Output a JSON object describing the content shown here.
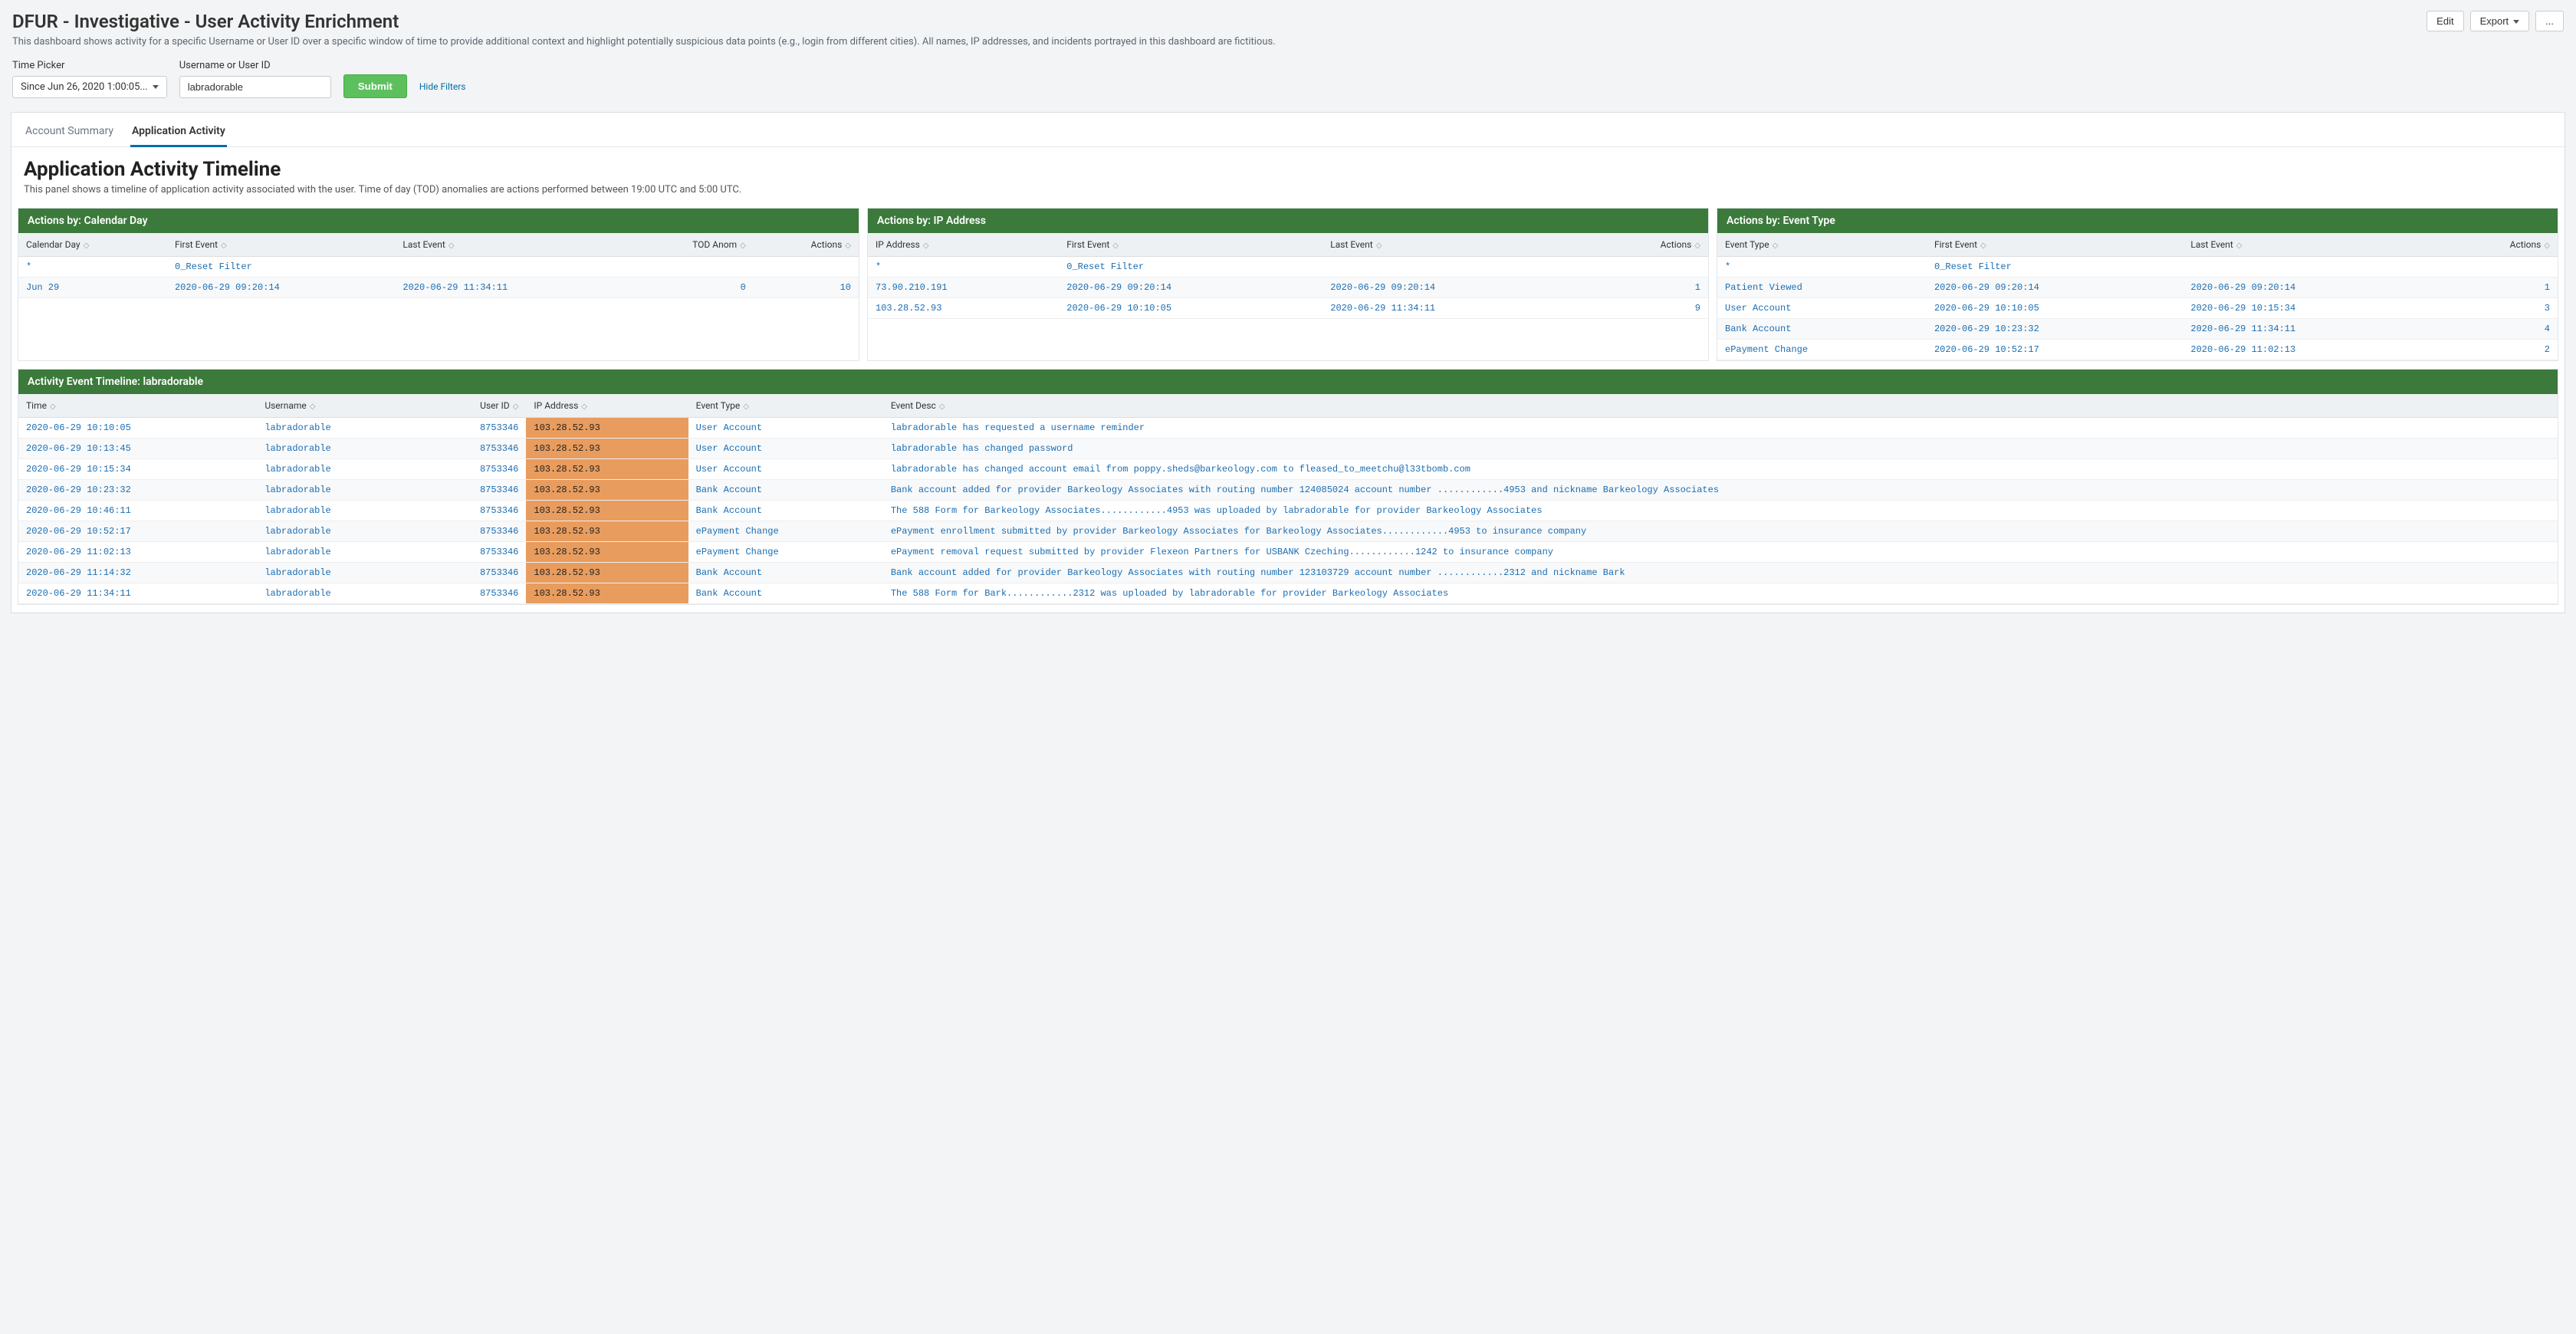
{
  "header": {
    "title": "DFUR - Investigative - User Activity Enrichment",
    "subtitle": "This dashboard shows activity for a specific Username or User ID over a specific window of time to provide additional context and highlight potentially suspicious data points (e.g., login from different cities). All names, IP addresses, and incidents portrayed in this dashboard are fictitious.",
    "edit": "Edit",
    "export": "Export",
    "more": "..."
  },
  "filters": {
    "timepicker_label": "Time Picker",
    "timepicker_value": "Since Jun 26, 2020 1:00:05...",
    "username_label": "Username or User ID",
    "username_value": "labradorable",
    "submit": "Submit",
    "hide_filters": "Hide Filters"
  },
  "tabs": {
    "summary": "Account Summary",
    "activity": "Application Activity"
  },
  "section": {
    "title": "Application Activity Timeline",
    "desc": "This panel shows a timeline of application activity associated with the user. Time of day (TOD) anomalies are actions performed between 19:00 UTC and 5:00 UTC."
  },
  "panel1": {
    "title": "Actions by: Calendar Day",
    "cols": {
      "c1": "Calendar Day",
      "c2": "First Event",
      "c3": "Last Event",
      "c4": "TOD Anom",
      "c5": "Actions"
    },
    "rows": [
      {
        "c1": "*",
        "c2": "0_Reset Filter",
        "c3": "",
        "c4": "",
        "c5": ""
      },
      {
        "c1": "Jun 29",
        "c2": "2020-06-29 09:20:14",
        "c3": "2020-06-29 11:34:11",
        "c4": "0",
        "c5": "10"
      }
    ]
  },
  "panel2": {
    "title": "Actions by: IP Address",
    "cols": {
      "c1": "IP Address",
      "c2": "First Event",
      "c3": "Last Event",
      "c4": "Actions"
    },
    "rows": [
      {
        "c1": "*",
        "c2": "0_Reset Filter",
        "c3": "",
        "c4": ""
      },
      {
        "c1": "73.90.210.191",
        "c2": "2020-06-29 09:20:14",
        "c3": "2020-06-29 09:20:14",
        "c4": "1"
      },
      {
        "c1": "103.28.52.93",
        "c2": "2020-06-29 10:10:05",
        "c3": "2020-06-29 11:34:11",
        "c4": "9"
      }
    ]
  },
  "panel3": {
    "title": "Actions by: Event Type",
    "cols": {
      "c1": "Event Type",
      "c2": "First Event",
      "c3": "Last Event",
      "c4": "Actions"
    },
    "rows": [
      {
        "c1": "*",
        "c2": "0_Reset Filter",
        "c3": "",
        "c4": ""
      },
      {
        "c1": "Patient Viewed",
        "c2": "2020-06-29 09:20:14",
        "c3": "2020-06-29 09:20:14",
        "c4": "1"
      },
      {
        "c1": "User Account",
        "c2": "2020-06-29 10:10:05",
        "c3": "2020-06-29 10:15:34",
        "c4": "3"
      },
      {
        "c1": "Bank Account",
        "c2": "2020-06-29 10:23:32",
        "c3": "2020-06-29 11:34:11",
        "c4": "4"
      },
      {
        "c1": "ePayment Change",
        "c2": "2020-06-29 10:52:17",
        "c3": "2020-06-29 11:02:13",
        "c4": "2"
      }
    ]
  },
  "timeline": {
    "title": "Activity Event Timeline: labradorable",
    "cols": {
      "c1": "Time",
      "c2": "Username",
      "c3": "User ID",
      "c4": "IP Address",
      "c5": "Event Type",
      "c6": "Event Desc"
    },
    "rows": [
      {
        "time": "2020-06-29 10:10:05",
        "user": "labradorable",
        "uid": "8753346",
        "ip": "103.28.52.93",
        "et": "User Account",
        "desc": "labradorable has requested a username reminder"
      },
      {
        "time": "2020-06-29 10:13:45",
        "user": "labradorable",
        "uid": "8753346",
        "ip": "103.28.52.93",
        "et": "User Account",
        "desc": "labradorable has changed password"
      },
      {
        "time": "2020-06-29 10:15:34",
        "user": "labradorable",
        "uid": "8753346",
        "ip": "103.28.52.93",
        "et": "User Account",
        "desc": "labradorable has changed account email from poppy.sheds@barkeology.com to fleased_to_meetchu@l33tbomb.com"
      },
      {
        "time": "2020-06-29 10:23:32",
        "user": "labradorable",
        "uid": "8753346",
        "ip": "103.28.52.93",
        "et": "Bank Account",
        "desc": "Bank account added for provider Barkeology Associates with routing number 124085024 account number ............4953 and nickname Barkeology Associates"
      },
      {
        "time": "2020-06-29 10:46:11",
        "user": "labradorable",
        "uid": "8753346",
        "ip": "103.28.52.93",
        "et": "Bank Account",
        "desc": "The 588 Form for Barkeology Associates............4953 was uploaded by labradorable for provider Barkeology Associates"
      },
      {
        "time": "2020-06-29 10:52:17",
        "user": "labradorable",
        "uid": "8753346",
        "ip": "103.28.52.93",
        "et": "ePayment Change",
        "desc": "ePayment enrollment submitted by provider Barkeology Associates for Barkeology Associates............4953 to insurance company"
      },
      {
        "time": "2020-06-29 11:02:13",
        "user": "labradorable",
        "uid": "8753346",
        "ip": "103.28.52.93",
        "et": "ePayment Change",
        "desc": "ePayment removal request submitted by provider Flexeon Partners for USBANK Czeching............1242 to insurance company"
      },
      {
        "time": "2020-06-29 11:14:32",
        "user": "labradorable",
        "uid": "8753346",
        "ip": "103.28.52.93",
        "et": "Bank Account",
        "desc": "Bank account added for provider Barkeology Associates with routing number 123103729 account number ............2312 and nickname Bark"
      },
      {
        "time": "2020-06-29 11:34:11",
        "user": "labradorable",
        "uid": "8753346",
        "ip": "103.28.52.93",
        "et": "Bank Account",
        "desc": "The 588 Form for Bark............2312 was uploaded by labradorable for provider Barkeology Associates"
      }
    ]
  }
}
